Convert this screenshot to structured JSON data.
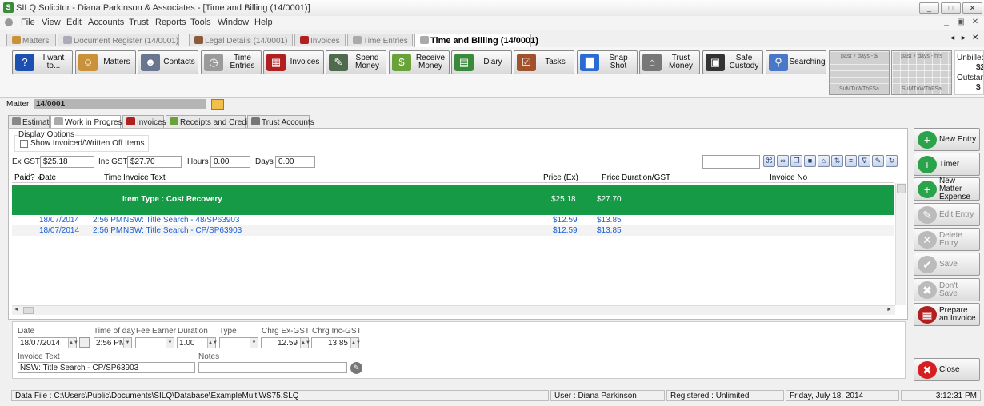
{
  "window": {
    "title": "SILQ Solicitor - Diana Parkinson & Associates - [Time and Billing (14/0001)]",
    "app_icon": "S",
    "controls": [
      "_",
      "□",
      "✕"
    ]
  },
  "menu": {
    "items": [
      "File",
      "View",
      "Edit",
      "Accounts",
      "Trust",
      "Reports",
      "Tools",
      "Window",
      "Help"
    ],
    "mdi_controls": [
      "_",
      "▣",
      "✕"
    ]
  },
  "doc_tabs": [
    {
      "label": "Matters"
    },
    {
      "label": "Document Register (14/0001)"
    },
    {
      "label": "Legal Details (14/0001)"
    },
    {
      "label": "Invoices"
    },
    {
      "label": "Time Entries"
    },
    {
      "label": "Time and Billing (14/0001)"
    }
  ],
  "doc_tab_nav": [
    "◄",
    "►",
    "✕"
  ],
  "toolbar": {
    "buttons": [
      {
        "label": "I want to...",
        "icon": "question-icon",
        "glyph": "?",
        "color": "#1b4fb0"
      },
      {
        "label": "Matters",
        "icon": "person-icon",
        "glyph": "☺",
        "color": "#c9923a"
      },
      {
        "label": "Contacts",
        "icon": "people-icon",
        "glyph": "☻",
        "color": "#6a7690"
      },
      {
        "label": "Time Entries",
        "icon": "stopwatch-icon",
        "glyph": "◷",
        "color": "#9a9a9a"
      },
      {
        "label": "Invoices",
        "icon": "calculator-icon",
        "glyph": "▦",
        "color": "#b02020"
      },
      {
        "label": "Spend Money",
        "icon": "pen-icon",
        "glyph": "✎",
        "color": "#4f6a4f"
      },
      {
        "label": "Receive Money",
        "icon": "cash-icon",
        "glyph": "$",
        "color": "#6aa23a"
      },
      {
        "label": "Diary",
        "icon": "calendar-icon",
        "glyph": "▤",
        "color": "#3b8a3b"
      },
      {
        "label": "Tasks",
        "icon": "checklist-icon",
        "glyph": "☑",
        "color": "#a0522d"
      },
      {
        "label": "Snap Shot",
        "icon": "bar-chart-icon",
        "glyph": "▇",
        "color": "#2a6bd1"
      },
      {
        "label": "Trust Money",
        "icon": "bank-icon",
        "glyph": "⌂",
        "color": "#777"
      },
      {
        "label": "Safe Custody",
        "icon": "safe-icon",
        "glyph": "▣",
        "color": "#333"
      },
      {
        "label": "Searching",
        "icon": "magnifier-icon",
        "glyph": "⚲",
        "color": "#4a78c8"
      }
    ],
    "mini_charts": [
      {
        "caption": "past 7 days - $",
        "days": "SuMTuWThFSa"
      },
      {
        "caption": "past 7 days - hrs",
        "days": "SuMTuWThFSa"
      }
    ],
    "summary": {
      "unbilled_label": "Unbilled",
      "unbilled_value": "$2",
      "outstanding_label": "Outstand",
      "outstanding_value": "$"
    }
  },
  "matter": {
    "label": "Matter",
    "value": "14/0001"
  },
  "inner_tabs": [
    {
      "label": "Estimate",
      "icon": "pencil-icon",
      "color": "#888"
    },
    {
      "label": "Work in Progress",
      "icon": "stopwatch-icon",
      "color": "#aaa"
    },
    {
      "label": "Invoices",
      "icon": "calculator-icon",
      "color": "#b02020"
    },
    {
      "label": "Receipts and Credits",
      "icon": "cash-icon",
      "color": "#6aa23a"
    },
    {
      "label": "Trust Accounts",
      "icon": "bank-icon",
      "color": "#777"
    }
  ],
  "display_options": {
    "title": "Display Options",
    "checkbox_label": "Show Invoiced/Written Off Items",
    "checked": false
  },
  "totals": {
    "ex_gst_label": "Ex GST",
    "ex_gst": "$25.18",
    "inc_gst_label": "Inc GST",
    "inc_gst": "$27.70",
    "hours_label": "Hours",
    "hours": "0.00",
    "days_label": "Days",
    "days": "0.00"
  },
  "grid_tools": [
    "binoculars-icon",
    "link-icon",
    "copy-icon",
    "save-icon",
    "lock-icon",
    "sort-icon",
    "columns-icon",
    "filter-icon",
    "edit-grid-icon",
    "refresh-icon"
  ],
  "grid_tool_glyphs": [
    "⌘",
    "∞",
    "❐",
    "■",
    "⌂",
    "⇅",
    "≡",
    "∇",
    "✎",
    "↻"
  ],
  "grid": {
    "columns": {
      "paid": "Paid? »",
      "date": "Date",
      "time": "Time",
      "text": "Invoice Text",
      "price_ex": "Price (Ex)",
      "price": "Price",
      "duration": "Duration/GST",
      "invoice_no": "Invoice No"
    },
    "group": {
      "label": "Item Type : Cost Recovery",
      "price_ex": "$25.18",
      "price": "$27.70"
    },
    "rows": [
      {
        "date": "18/07/2014",
        "time": "2:56 PM",
        "text": "NSW: Title Search - 48/SP63903",
        "price_ex": "$12.59",
        "price": "$13.85"
      },
      {
        "date": "18/07/2014",
        "time": "2:56 PM",
        "text": "NSW: Title Search - CP/SP63903",
        "price_ex": "$12.59",
        "price": "$13.85"
      }
    ]
  },
  "side_buttons": [
    {
      "label": "New Entry",
      "icon": "new-entry-icon",
      "glyph": "+",
      "color": "#2aa34a",
      "enabled": true
    },
    {
      "label": "Timer",
      "icon": "timer-icon",
      "glyph": "+",
      "color": "#2aa34a",
      "enabled": true
    },
    {
      "label": "New Matter Expense",
      "icon": "new-expense-icon",
      "glyph": "+",
      "color": "#2aa34a",
      "enabled": true
    },
    {
      "label": "Edit Entry",
      "icon": "edit-entry-icon",
      "glyph": "✎",
      "color": "#bbb",
      "enabled": false
    },
    {
      "label": "Delete Entry",
      "icon": "delete-entry-icon",
      "glyph": "✕",
      "color": "#bbb",
      "enabled": false
    },
    {
      "label": "Save",
      "icon": "checkmark-icon",
      "glyph": "✔",
      "color": "#bbb",
      "enabled": false
    },
    {
      "label": "Don't Save",
      "icon": "x-icon",
      "glyph": "✖",
      "color": "#bbb",
      "enabled": false
    },
    {
      "label": "Prepare an Invoice",
      "icon": "calculator-icon",
      "glyph": "▦",
      "color": "#b02020",
      "enabled": true
    },
    {
      "label": "Close",
      "icon": "close-icon",
      "glyph": "✖",
      "color": "#d42020",
      "enabled": true
    }
  ],
  "form": {
    "date_label": "Date",
    "date": "18/07/2014",
    "time_label": "Time of day",
    "time": "2:56 PM",
    "fee_earner_label": "Fee Earner",
    "fee_earner": "",
    "duration_label": "Duration",
    "duration": "1.00",
    "type_label": "Type",
    "type": "",
    "chrg_ex_label": "Chrg Ex-GST",
    "chrg_ex": "12.59",
    "chrg_inc_label": "Chrg Inc-GST",
    "chrg_inc": "13.85",
    "invoice_text_label": "Invoice Text",
    "invoice_text": "NSW: Title Search - CP/SP63903",
    "notes_label": "Notes",
    "notes": ""
  },
  "status": {
    "data_file": "Data File : C:\\Users\\Public\\Documents\\SILQ\\Database\\ExampleMultiWS75.SLQ",
    "user": "User : Diana Parkinson",
    "registered": "Registered : Unlimited",
    "date": "Friday, July 18, 2014",
    "time": "3:12:31 PM"
  }
}
